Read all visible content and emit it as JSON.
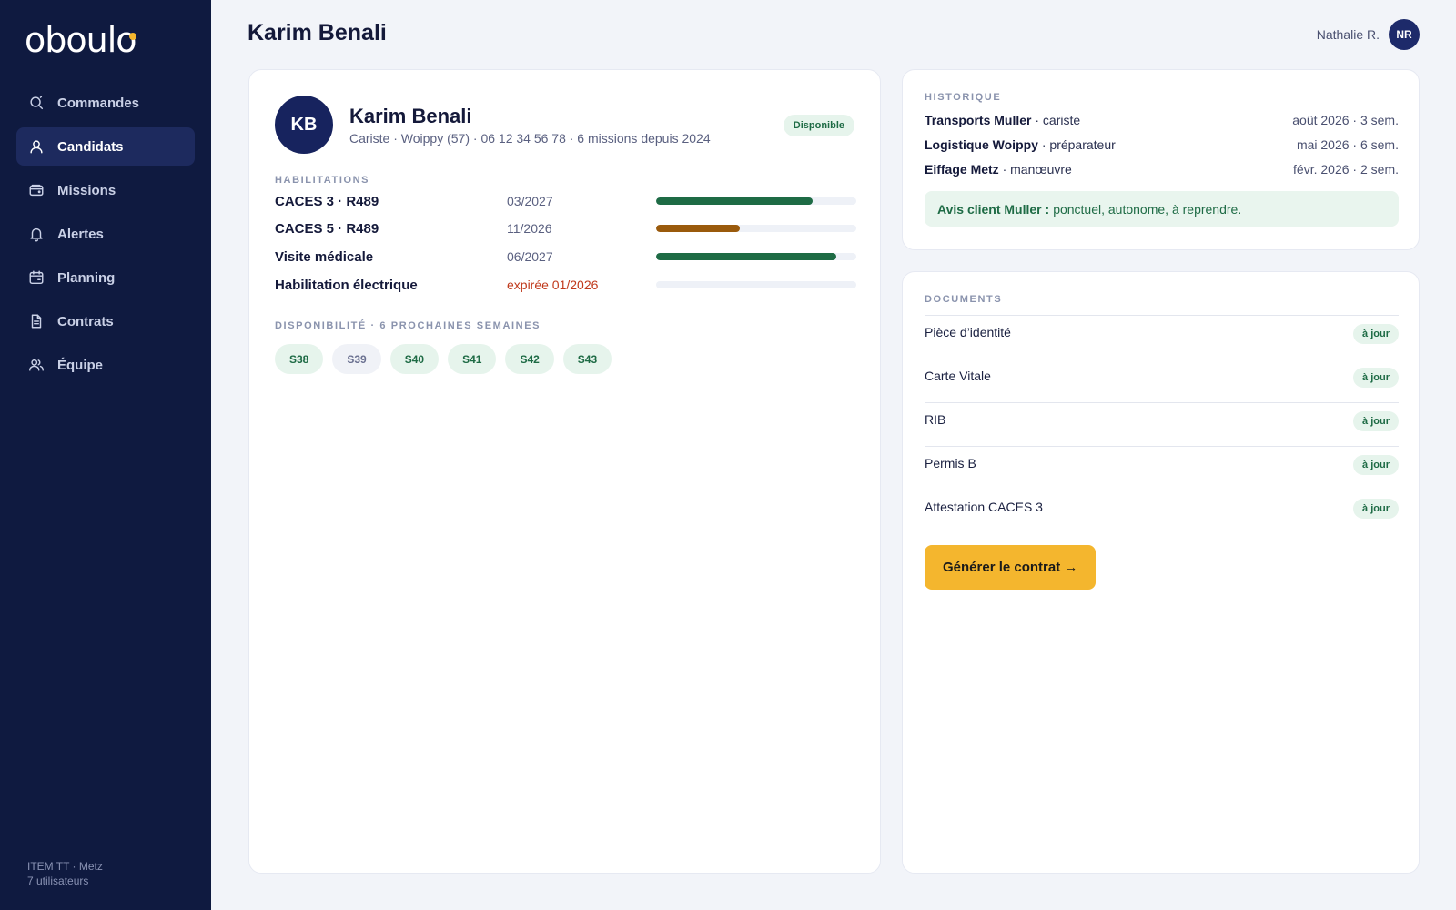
{
  "app": {
    "logo": "oboulo"
  },
  "sidebar": {
    "items": [
      {
        "label": "Commandes",
        "icon": "search-icon",
        "active": false
      },
      {
        "label": "Candidats",
        "icon": "user-icon",
        "active": true
      },
      {
        "label": "Missions",
        "icon": "wallet-icon",
        "active": false
      },
      {
        "label": "Alertes",
        "icon": "bell-icon",
        "active": false
      },
      {
        "label": "Planning",
        "icon": "calendar-icon",
        "active": false
      },
      {
        "label": "Contrats",
        "icon": "document-icon",
        "active": false
      },
      {
        "label": "Équipe",
        "icon": "users-icon",
        "active": false
      }
    ],
    "footer": {
      "line1": "ITEM TT · Metz",
      "line2": "7 utilisateurs"
    }
  },
  "header": {
    "title": "Karim Benali",
    "user_name": "Nathalie R.",
    "user_initials": "NR"
  },
  "profile": {
    "initials": "KB",
    "name": "Karim Benali",
    "subtitle": "Cariste · Woippy (57) · 06 12 34 56 78 · 6 missions depuis 2024",
    "status": "Disponible"
  },
  "habilitations": {
    "label": "HABILITATIONS",
    "items": [
      {
        "name": "CACES 3 · R489",
        "date": "03/2027",
        "level": 0.78,
        "status": "valid",
        "color": "#1e6b45"
      },
      {
        "name": "CACES 5 · R489",
        "date": "11/2026",
        "level": 0.42,
        "status": "warning",
        "color": "#9a5a0c"
      },
      {
        "name": "Visite médicale",
        "date": "06/2027",
        "level": 0.9,
        "status": "valid",
        "color": "#1e6b45"
      },
      {
        "name": "Habilitation électrique",
        "date": "expirée 01/2026",
        "level": 0,
        "status": "expired",
        "color": "#c0391b"
      }
    ]
  },
  "availability": {
    "label": "DISPONIBILITÉ · 6 PROCHAINES SEMAINES",
    "weeks": [
      {
        "label": "S38",
        "available": true
      },
      {
        "label": "S39",
        "available": false
      },
      {
        "label": "S40",
        "available": true
      },
      {
        "label": "S41",
        "available": true
      },
      {
        "label": "S42",
        "available": true
      },
      {
        "label": "S43",
        "available": true
      }
    ]
  },
  "history": {
    "label": "HISTORIQUE",
    "items": [
      {
        "company": "Transports Muller",
        "role": " · cariste",
        "date": "août 2026 · 3 sem."
      },
      {
        "company": "Logistique Woippy",
        "role": " · préparateur",
        "date": "mai 2026 · 6 sem."
      },
      {
        "company": "Eiffage Metz",
        "role": " · manœuvre",
        "date": "févr. 2026 · 2 sem."
      }
    ],
    "review_label": "Avis client Muller :",
    "review_text": "ponctuel, autonome, à reprendre."
  },
  "documents": {
    "label": "DOCUMENTS",
    "items": [
      {
        "name": "Pièce d’identité",
        "status": "à jour"
      },
      {
        "name": "Carte Vitale",
        "status": "à jour"
      },
      {
        "name": "RIB",
        "status": "à jour"
      },
      {
        "name": "Permis B",
        "status": "à jour"
      },
      {
        "name": "Attestation CACES 3",
        "status": "à jour"
      }
    ],
    "cta": "Générer le contrat →"
  },
  "colors": {
    "sidebar_bg": "#0f1a40",
    "accent": "#f4b62e",
    "success": "#1e6b45",
    "warning": "#9a5a0c",
    "danger": "#c0391b"
  }
}
